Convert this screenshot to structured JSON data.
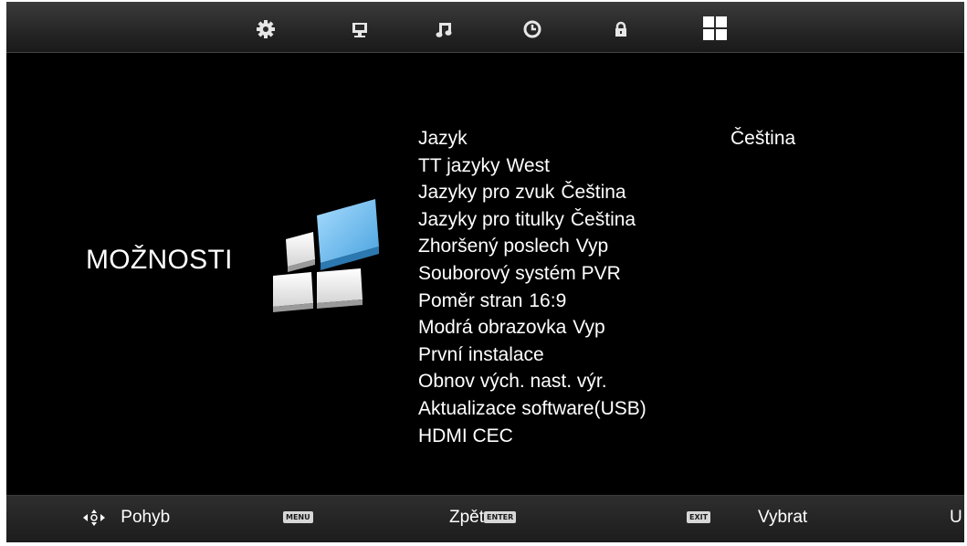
{
  "topbar": {
    "tabs": [
      {
        "icon": "gear-icon",
        "active": false
      },
      {
        "icon": "monitor-icon",
        "active": false
      },
      {
        "icon": "music-note-icon",
        "active": false
      },
      {
        "icon": "clock-icon",
        "active": false
      },
      {
        "icon": "lock-icon",
        "active": false
      },
      {
        "icon": "options-grid-icon",
        "active": true
      }
    ]
  },
  "section": {
    "title": "MOŽNOSTI",
    "logo_icon": "options-tiles-icon"
  },
  "menu": {
    "items": [
      {
        "label": "Jazyk",
        "value": "Čeština"
      },
      {
        "label": "TT jazyky",
        "value": "West"
      },
      {
        "label": "Jazyky pro zvuk",
        "value": "Čeština"
      },
      {
        "label": "Jazyky pro titulky",
        "value": "Čeština"
      },
      {
        "label": "Zhoršený poslech",
        "value": "Vyp"
      },
      {
        "label": "Souborový systém PVR",
        "value": ""
      },
      {
        "label": "Poměr stran",
        "value": "16:9"
      },
      {
        "label": "Modrá obrazovka",
        "value": "Vyp"
      },
      {
        "label": "První instalace",
        "value": ""
      },
      {
        "label": "Obnov vých. nast. výr.",
        "value": ""
      },
      {
        "label": "Aktualizace software(USB)",
        "value": ""
      },
      {
        "label": "HDMI CEC",
        "value": ""
      }
    ]
  },
  "bottombar": {
    "move_label": "Pohyb",
    "menu_key": "MENU",
    "back_label": "Zpět",
    "enter_key": "ENTER",
    "exit_key": "EXIT",
    "select_label": "Vybrat",
    "cut_label": "U"
  },
  "colors": {
    "background": "#000000",
    "text": "#ffffff",
    "accent_tile": "#5fb3e6"
  }
}
